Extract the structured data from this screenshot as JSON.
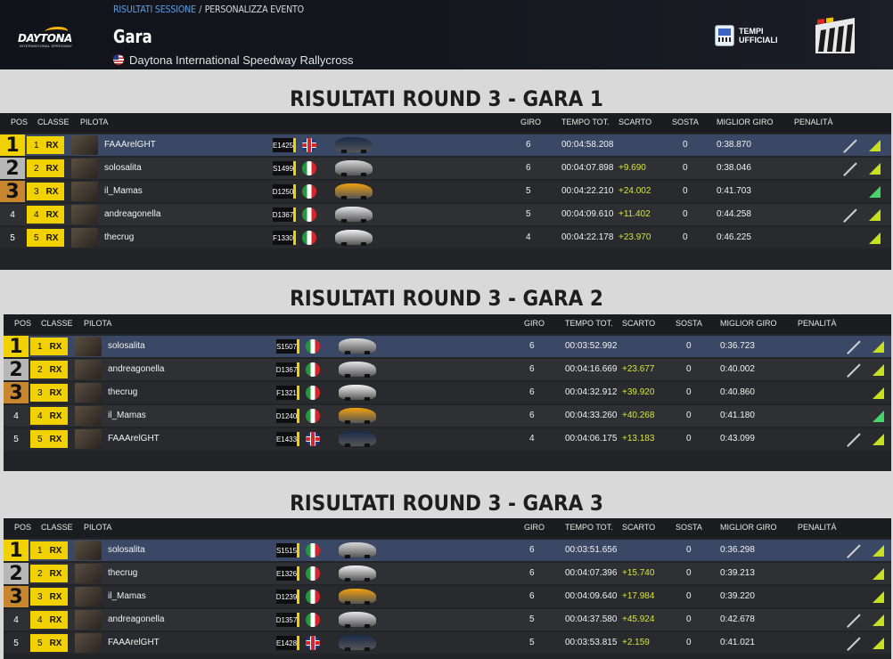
{
  "header": {
    "logo_text": "DAYTONA",
    "logo_sub": "INTERNATIONAL SPEEDWAY",
    "breadcrumb_active": "RISULTATI SESSIONE",
    "breadcrumb_sep": "/",
    "breadcrumb_next": "PERSONALIZZA EVENTO",
    "title": "Gara",
    "track": "Daytona International Speedway Rallycross",
    "official_times": "TEMPI UFFICIALI"
  },
  "columns": {
    "pos": "POS",
    "classe": "CLASSE",
    "pilota": "PILOTA",
    "giro": "GIRO",
    "tempo": "TEMPO TOT.",
    "scarto": "SCARTO",
    "sosta": "SOSTA",
    "miglior": "MIGLIOR GIRO",
    "penalita": "PENALITÀ"
  },
  "races": [
    {
      "title": "RISULTATI ROUND 3 - GARA 1",
      "rows": [
        {
          "pos": "1",
          "cnum": "1",
          "class": "RX",
          "driver": "FAAArelGHT",
          "rating": "E1425",
          "flag": "gb",
          "car": "#1a2a4a",
          "laps": "6",
          "time": "00:04:58.208",
          "gap": "",
          "stops": "0",
          "best": "0:38.870",
          "slash": true,
          "tri": "yellow"
        },
        {
          "pos": "2",
          "cnum": "2",
          "class": "RX",
          "driver": "solosalita",
          "rating": "S1499",
          "flag": "it",
          "car": "#d8d8d8",
          "laps": "6",
          "time": "00:04:07.898",
          "gap": "+9.690",
          "stops": "0",
          "best": "0:38.046",
          "slash": true,
          "tri": "yellow"
        },
        {
          "pos": "3",
          "cnum": "3",
          "class": "RX",
          "driver": "il_Mamas",
          "rating": "D1250",
          "flag": "it",
          "car": "#f0a010",
          "laps": "5",
          "time": "00:04:22.210",
          "gap": "+24.002",
          "stops": "0",
          "best": "0:41.703",
          "slash": false,
          "tri": "green"
        },
        {
          "pos": "4",
          "cnum": "4",
          "class": "RX",
          "driver": "andreagonella",
          "rating": "D1367",
          "flag": "it",
          "car": "#e6e6ee",
          "laps": "5",
          "time": "00:04:09.610",
          "gap": "+11.402",
          "stops": "0",
          "best": "0:44.258",
          "slash": true,
          "tri": "yellow"
        },
        {
          "pos": "5",
          "cnum": "5",
          "class": "RX",
          "driver": "thecrug",
          "rating": "F1330",
          "flag": "it",
          "car": "#f2f2f2",
          "laps": "4",
          "time": "00:04:22.178",
          "gap": "+23.970",
          "stops": "0",
          "best": "0:46.225",
          "slash": false,
          "tri": "yellow"
        }
      ]
    },
    {
      "title": "RISULTATI ROUND 3 - GARA 2",
      "rows": [
        {
          "pos": "1",
          "cnum": "1",
          "class": "RX",
          "driver": "solosalita",
          "rating": "S1507",
          "flag": "it",
          "car": "#d8d8d8",
          "laps": "6",
          "time": "00:03:52.992",
          "gap": "",
          "stops": "0",
          "best": "0:36.723",
          "slash": true,
          "tri": "yellow"
        },
        {
          "pos": "2",
          "cnum": "2",
          "class": "RX",
          "driver": "andreagonella",
          "rating": "D1367",
          "flag": "it",
          "car": "#e6e6ee",
          "laps": "6",
          "time": "00:04:16.669",
          "gap": "+23.677",
          "stops": "0",
          "best": "0:40.002",
          "slash": true,
          "tri": "yellow"
        },
        {
          "pos": "3",
          "cnum": "3",
          "class": "RX",
          "driver": "thecrug",
          "rating": "F1321",
          "flag": "it",
          "car": "#f2f2f2",
          "laps": "6",
          "time": "00:04:32.912",
          "gap": "+39.920",
          "stops": "0",
          "best": "0:40.860",
          "slash": false,
          "tri": "yellow"
        },
        {
          "pos": "4",
          "cnum": "4",
          "class": "RX",
          "driver": "il_Mamas",
          "rating": "D1240",
          "flag": "it",
          "car": "#f0a010",
          "laps": "6",
          "time": "00:04:33.260",
          "gap": "+40.268",
          "stops": "0",
          "best": "0:41.180",
          "slash": false,
          "tri": "green"
        },
        {
          "pos": "5",
          "cnum": "5",
          "class": "RX",
          "driver": "FAAArelGHT",
          "rating": "E1433",
          "flag": "gb",
          "car": "#1a2a4a",
          "laps": "4",
          "time": "00:04:06.175",
          "gap": "+13.183",
          "stops": "0",
          "best": "0:43.099",
          "slash": true,
          "tri": "yellow"
        }
      ]
    },
    {
      "title": "RISULTATI ROUND 3 - GARA 3",
      "rows": [
        {
          "pos": "1",
          "cnum": "1",
          "class": "RX",
          "driver": "solosalita",
          "rating": "S1515",
          "flag": "it",
          "car": "#d8d8d8",
          "laps": "6",
          "time": "00:03:51.656",
          "gap": "",
          "stops": "0",
          "best": "0:36.298",
          "slash": true,
          "tri": "yellow"
        },
        {
          "pos": "2",
          "cnum": "2",
          "class": "RX",
          "driver": "thecrug",
          "rating": "E1326",
          "flag": "it",
          "car": "#f2f2f2",
          "laps": "6",
          "time": "00:04:07.396",
          "gap": "+15.740",
          "stops": "0",
          "best": "0:39.213",
          "slash": false,
          "tri": "yellow"
        },
        {
          "pos": "3",
          "cnum": "3",
          "class": "RX",
          "driver": "il_Mamas",
          "rating": "D1239",
          "flag": "it",
          "car": "#f0a010",
          "laps": "6",
          "time": "00:04:09.640",
          "gap": "+17.984",
          "stops": "0",
          "best": "0:39.220",
          "slash": false,
          "tri": "yellow"
        },
        {
          "pos": "4",
          "cnum": "4",
          "class": "RX",
          "driver": "andreagonella",
          "rating": "D1357",
          "flag": "it",
          "car": "#e6e6ee",
          "laps": "5",
          "time": "00:04:37.580",
          "gap": "+45.924",
          "stops": "0",
          "best": "0:42.678",
          "slash": true,
          "tri": "yellow"
        },
        {
          "pos": "5",
          "cnum": "5",
          "class": "RX",
          "driver": "FAAArelGHT",
          "rating": "E1428",
          "flag": "gb",
          "car": "#1a2a4a",
          "laps": "5",
          "time": "00:03:53.815",
          "gap": "+2.159",
          "stops": "0",
          "best": "0:41.021",
          "slash": true,
          "tri": "yellow"
        }
      ]
    }
  ],
  "colors": {
    "accent_yellow": "#f2d100",
    "silver": "#b7b7b7",
    "bronze": "#c8862e",
    "row_highlight": "#3b4a6a",
    "row_dark": "#2b2c30",
    "row_light": "#35363a",
    "gap_text": "#d6e43c"
  }
}
